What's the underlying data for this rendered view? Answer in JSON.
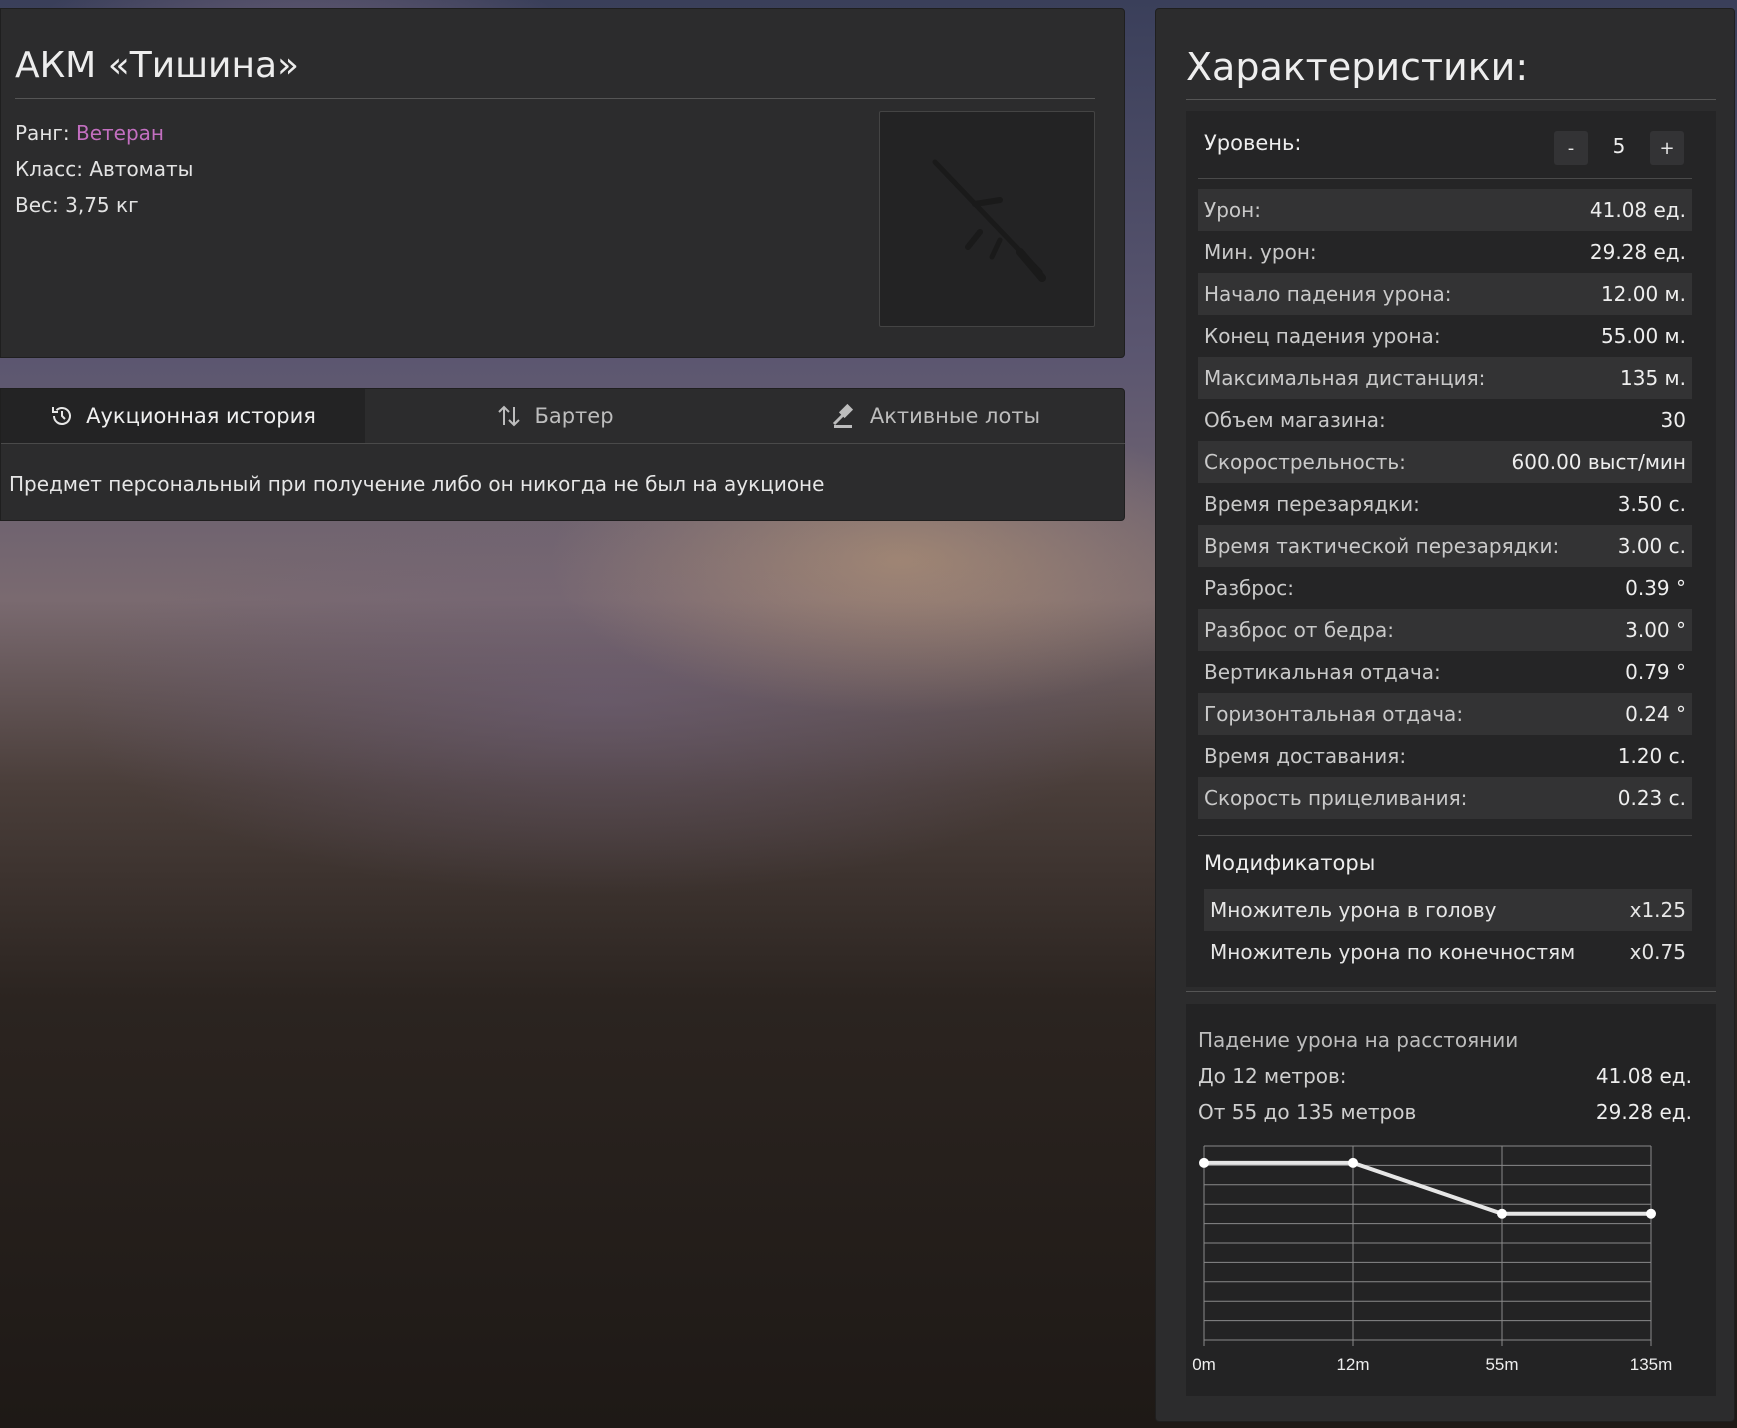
{
  "item": {
    "title": "АКМ «Тишина»",
    "rank_label": "Ранг:",
    "rank_value": "Ветеран",
    "rank_color": "#c36fc0",
    "class_line": "Класс: Автоматы",
    "weight_line": "Вес: 3,75 кг",
    "image_icon": "rifle-icon"
  },
  "tabs": [
    {
      "label": "Аукционная история",
      "icon": "history-icon",
      "active": true
    },
    {
      "label": "Бартер",
      "icon": "swap-arrows-icon",
      "active": false
    },
    {
      "label": "Активные лоты",
      "icon": "gavel-icon",
      "active": false
    }
  ],
  "tab_message": "Предмет персональный при получение либо он никогда не был на аукционе",
  "stats": {
    "title": "Характеристики:",
    "level": {
      "label": "Уровень:",
      "value": "5",
      "minus": "-",
      "plus": "+"
    },
    "rows": [
      {
        "key": "Урон:",
        "value": "41.08 ед."
      },
      {
        "key": "Мин. урон:",
        "value": "29.28 ед."
      },
      {
        "key": "Начало падения урона:",
        "value": "12.00 м."
      },
      {
        "key": "Конец падения урона:",
        "value": "55.00 м."
      },
      {
        "key": "Максимальная дистанция:",
        "value": "135 м."
      },
      {
        "key": "Объем магазина:",
        "value": "30"
      },
      {
        "key": "Скорострельность:",
        "value": "600.00 выст/мин"
      },
      {
        "key": "Время перезарядки:",
        "value": "3.50 с."
      },
      {
        "key": "Время тактической перезарядки:",
        "value": "3.00 с."
      },
      {
        "key": "Разброс:",
        "value": "0.39 °"
      },
      {
        "key": "Разброс от бедра:",
        "value": "3.00 °"
      },
      {
        "key": "Вертикальная отдача:",
        "value": "0.79 °"
      },
      {
        "key": "Горизонтальная отдача:",
        "value": "0.24 °"
      },
      {
        "key": "Время доставания:",
        "value": "1.20 с."
      },
      {
        "key": "Скорость прицеливания:",
        "value": "0.23 с."
      }
    ],
    "modifiers_title": "Модификаторы",
    "modifiers": [
      {
        "key": "Множитель урона в голову",
        "value": "x1.25"
      },
      {
        "key": "Множитель урона по конечностям",
        "value": "x0.75"
      }
    ]
  },
  "falloff": {
    "title": "Падение урона на расстоянии",
    "rows": [
      {
        "key": "До 12 метров:",
        "value": "41.08 ед."
      },
      {
        "key": "От 55 до 135 метров",
        "value": "29.28 ед."
      }
    ]
  },
  "chart_data": {
    "type": "line",
    "categories": [
      "0m",
      "12m",
      "55m",
      "135m"
    ],
    "values": [
      41.08,
      41.08,
      29.28,
      29.28
    ],
    "ylim": [
      0,
      45
    ],
    "grid": true,
    "line_color": "#e6e6e6"
  }
}
